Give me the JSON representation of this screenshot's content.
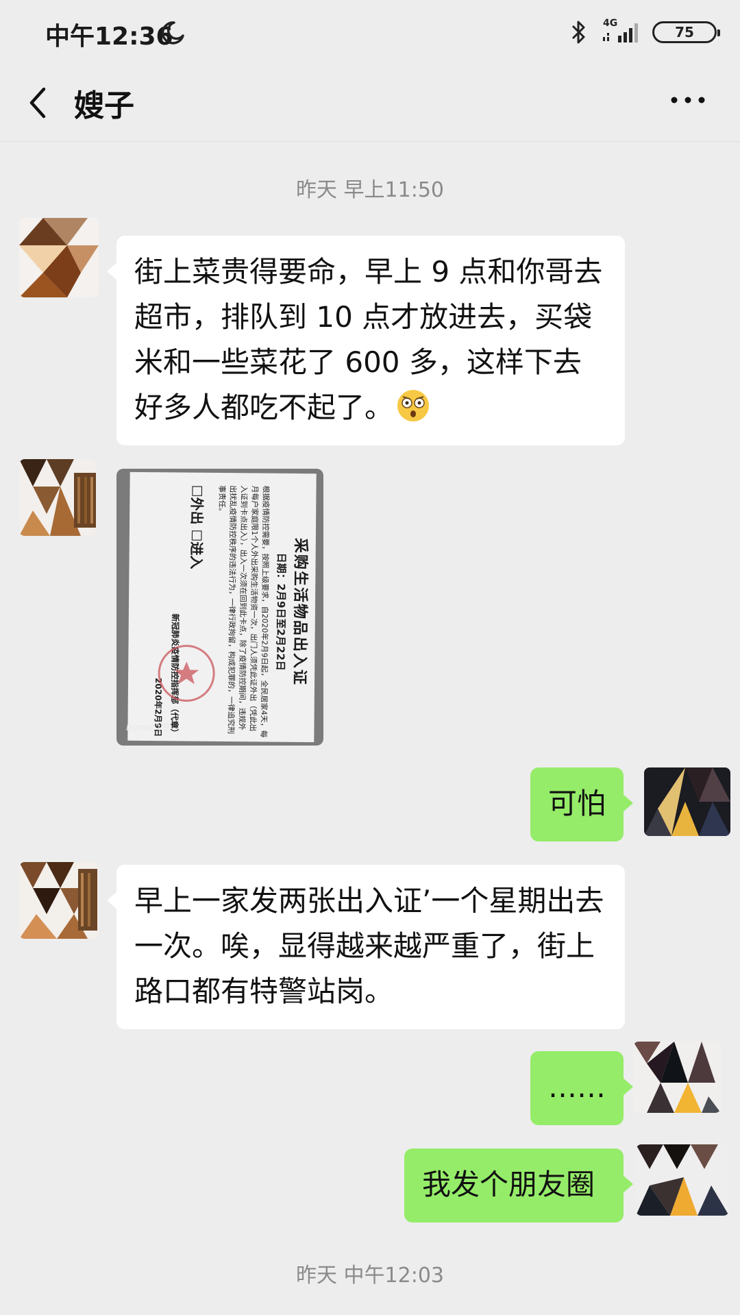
{
  "status_bar": {
    "time": "中午12:36",
    "network": "4G",
    "battery": "75"
  },
  "header": {
    "back_icon": "chevron-left-icon",
    "title": "嫂子",
    "more_icon": "more-dots-icon"
  },
  "timestamps": [
    "昨天 早上11:50",
    "昨天 中午12:03"
  ],
  "messages": [
    {
      "direction": "in",
      "type": "text",
      "text": "街上菜贵得要命，早上 9 点和你哥去超市，排队到 10 点才放进去，买袋米和一些菜花了 600 多，这样下去好多人都吃不起了。",
      "emoji": "astonished-face-icon"
    },
    {
      "direction": "in",
      "type": "image",
      "photo": {
        "title": "采购生活物品出入证",
        "date": "日期：2月9日至2月22日",
        "body": "根据疫情防控需要，按照上级要求，自2020年2月9日起，全民居家4天，每月每户家庭限1个人外出采购生活物资一次，出门人须凭此证外出（凭此出入证到卡点出入），出入一次须在回到此卡点，除了疫情防控期间，违规外出扰乱疫情防控秩序的违法行为，一律行政拘留，构成犯罪的，一律追究刑事责任。",
        "options": "☐外出 ☐进入",
        "signature": "新冠肺炎疫情防控指挥部（代章）",
        "sign_date": "2020年2月9日",
        "brand": "honor V9"
      }
    },
    {
      "direction": "out",
      "type": "text",
      "text": "可怕"
    },
    {
      "direction": "in",
      "type": "text",
      "text": "早上一家发两张出入证’一个星期出去一次。唉，显得越来越严重了，街上路口都有特警站岗。"
    },
    {
      "direction": "out",
      "type": "text",
      "text": "……"
    },
    {
      "direction": "out",
      "type": "text",
      "text": "我发个朋友圈"
    }
  ]
}
